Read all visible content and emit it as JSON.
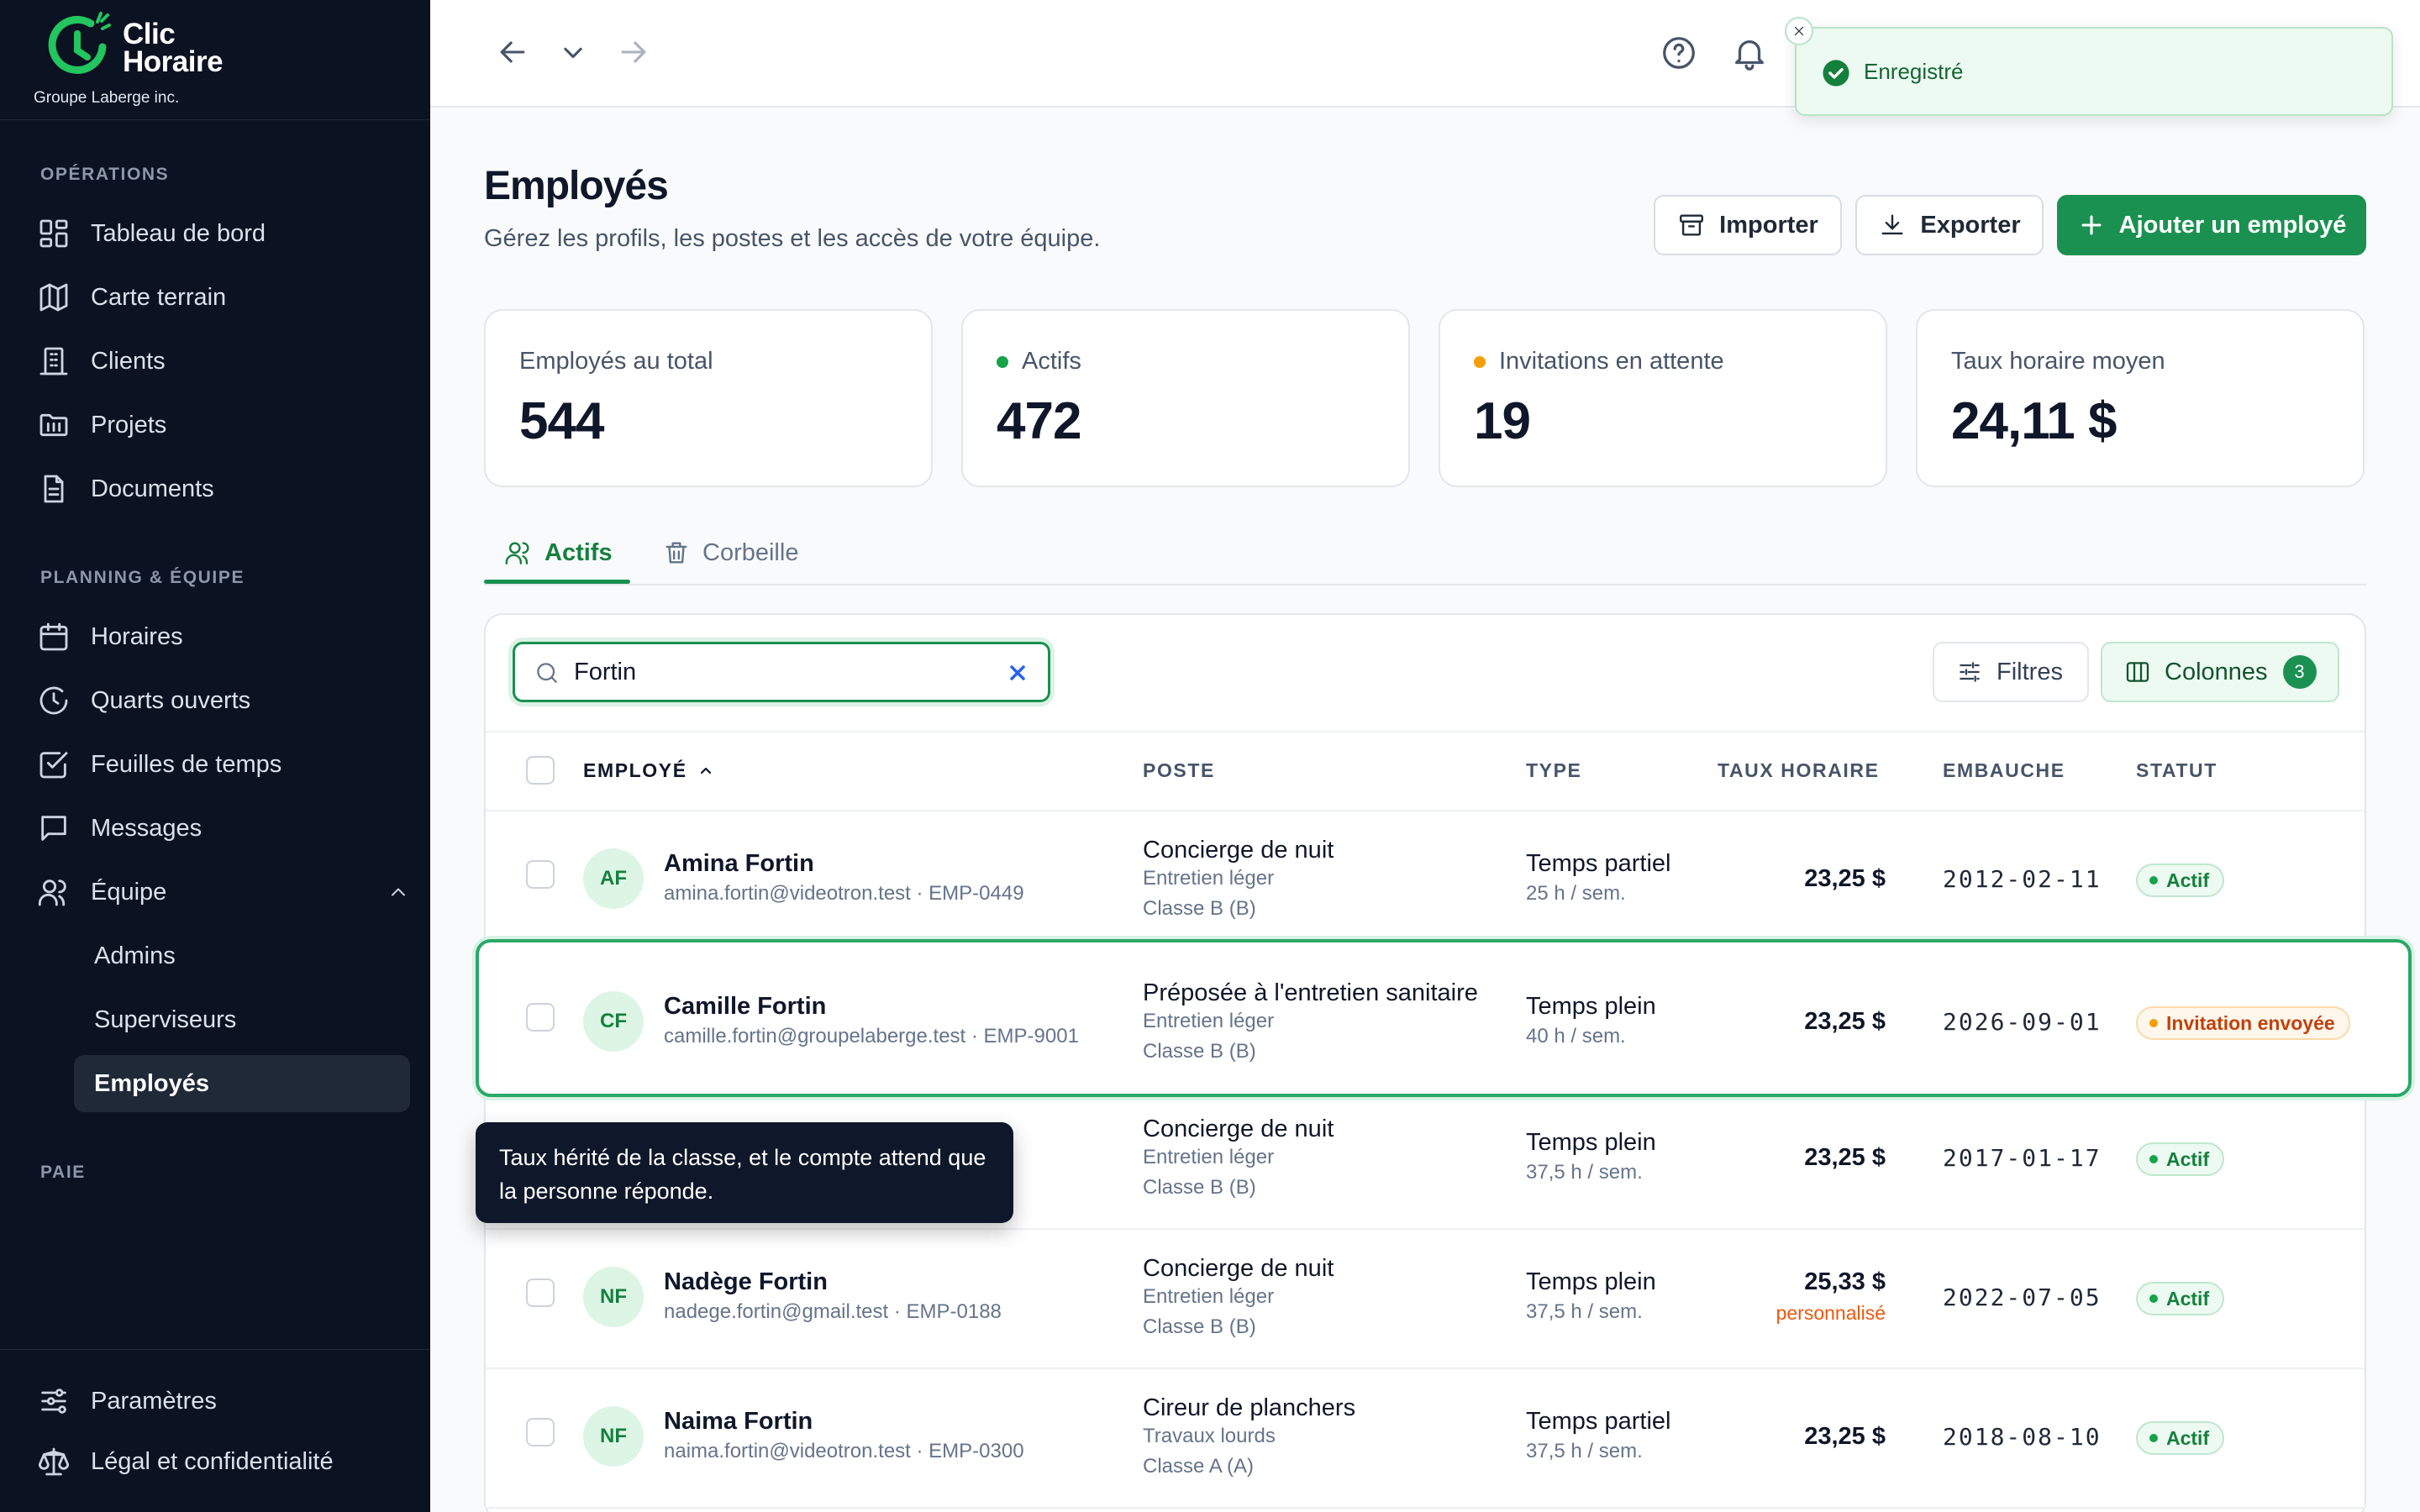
{
  "brand": {
    "name_line1": "Clic",
    "name_line2": "Horaire",
    "company": "Groupe Laberge inc."
  },
  "sidebar": {
    "sections": {
      "operations": "OPÉRATIONS",
      "planning": "PLANNING & ÉQUIPE",
      "paie": "PAIE"
    },
    "operations": [
      {
        "label": "Tableau de bord",
        "icon": "dashboard-icon"
      },
      {
        "label": "Carte terrain",
        "icon": "map-icon"
      },
      {
        "label": "Clients",
        "icon": "building-icon"
      },
      {
        "label": "Projets",
        "icon": "folder-icon"
      },
      {
        "label": "Documents",
        "icon": "document-icon"
      }
    ],
    "planning": [
      {
        "label": "Horaires",
        "icon": "calendar-icon"
      },
      {
        "label": "Quarts ouverts",
        "icon": "clock-icon"
      },
      {
        "label": "Feuilles de temps",
        "icon": "checkbox-icon"
      },
      {
        "label": "Messages",
        "icon": "message-icon"
      },
      {
        "label": "Équipe",
        "icon": "users-icon"
      }
    ],
    "team_sub": [
      "Admins",
      "Superviseurs",
      "Employés"
    ],
    "bottom": [
      {
        "label": "Paramètres",
        "icon": "sliders-icon"
      },
      {
        "label": "Légal et confidentialité",
        "icon": "scale-icon"
      }
    ]
  },
  "toast": {
    "message": "Enregistré"
  },
  "header": {
    "title": "Employés",
    "subtitle": "Gérez les profils, les postes et les accès de votre équipe.",
    "import_label": "Importer",
    "export_label": "Exporter",
    "add_label": "Ajouter un employé"
  },
  "stats": [
    {
      "label": "Employés au total",
      "value": "544"
    },
    {
      "label": "Actifs",
      "value": "472",
      "dot": "#16a34a"
    },
    {
      "label": "Invitations en attente",
      "value": "19",
      "dot": "#f59e0b"
    },
    {
      "label": "Taux horaire moyen",
      "value": "24,11 $"
    }
  ],
  "tabs": [
    {
      "label": "Actifs"
    },
    {
      "label": "Corbeille"
    }
  ],
  "search": {
    "value": "Fortin"
  },
  "toolbar": {
    "filters_label": "Filtres",
    "columns_label": "Colonnes",
    "columns_count": "3"
  },
  "columns": {
    "employee": "EMPLOYÉ",
    "position": "POSTE",
    "type": "TYPE",
    "rate": "TAUX HORAIRE",
    "hire": "EMBAUCHE",
    "status": "STATUT"
  },
  "rows": [
    {
      "initials": "AF",
      "name": "Amina Fortin",
      "email": "amina.fortin@videotron.test · EMP-0449",
      "position": "Concierge de nuit",
      "category": "Entretien léger",
      "class": "Classe B (B)",
      "type": "Temps partiel",
      "hours": "25 h / sem.",
      "rate": "23,25 $",
      "hire": "2012-02-11",
      "status": "Actif"
    },
    {
      "initials": "CF",
      "name": "Camille Fortin",
      "email": "camille.fortin@groupelaberge.test · EMP-9001",
      "position": "Préposée à l'entretien sanitaire",
      "category": "Entretien léger",
      "class": "Classe B (B)",
      "type": "Temps plein",
      "hours": "40 h / sem.",
      "rate": "23,25 $",
      "hire": "2026-09-01",
      "status": "Invitation envoyée"
    },
    {
      "initials": "",
      "name": "",
      "email": "",
      "position": "Concierge de nuit",
      "category": "Entretien léger",
      "class": "Classe B (B)",
      "type": "Temps plein",
      "hours": "37,5 h / sem.",
      "rate": "23,25 $",
      "hire": "2017-01-17",
      "status": "Actif"
    },
    {
      "initials": "NF",
      "name": "Nadège Fortin",
      "email": "nadege.fortin@gmail.test · EMP-0188",
      "position": "Concierge de nuit",
      "category": "Entretien léger",
      "class": "Classe B (B)",
      "type": "Temps plein",
      "hours": "37,5 h / sem.",
      "rate": "25,33 $",
      "rate_note": "personnalisé",
      "hire": "2022-07-05",
      "status": "Actif"
    },
    {
      "initials": "NF",
      "name": "Naima Fortin",
      "email": "naima.fortin@videotron.test · EMP-0300",
      "position": "Cireur de planchers",
      "category": "Travaux lourds",
      "class": "Classe A (A)",
      "type": "Temps partiel",
      "hours": "37,5 h / sem.",
      "rate": "23,25 $",
      "hire": "2018-08-10",
      "status": "Actif"
    }
  ],
  "tooltip": {
    "text": "Taux hérité de la classe, et le compte attend que la personne réponde."
  }
}
